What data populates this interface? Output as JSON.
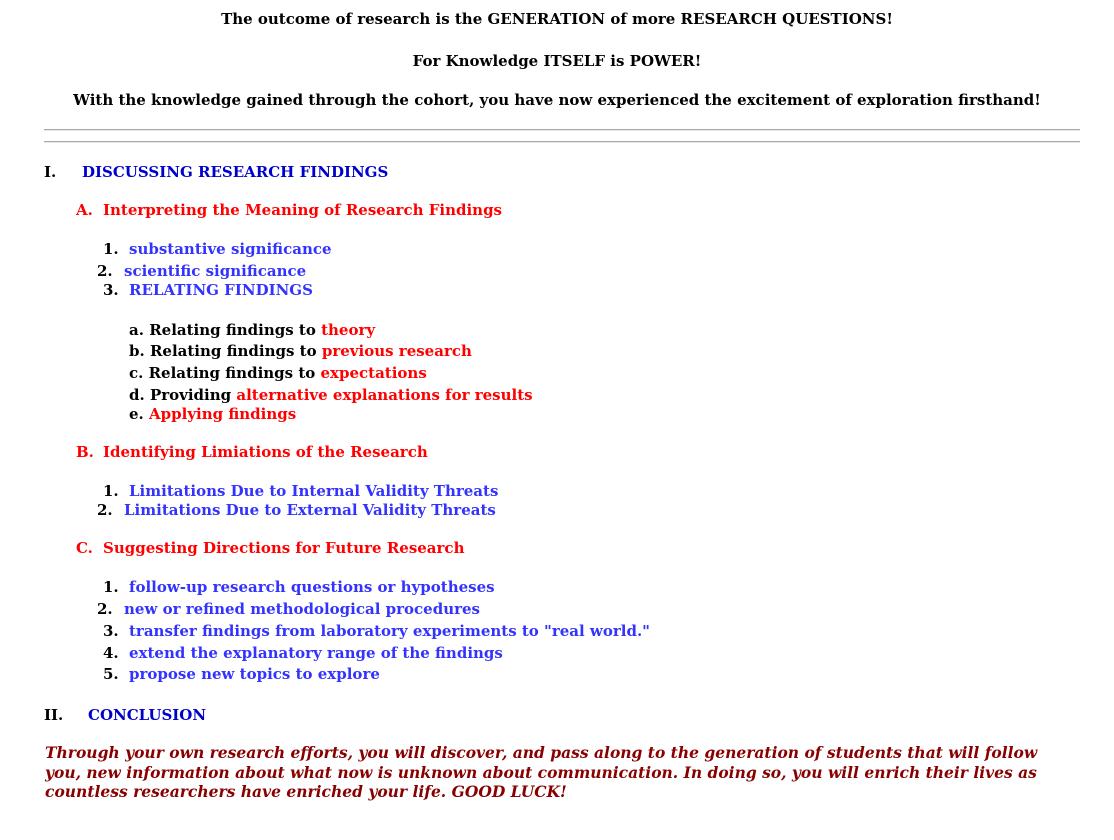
{
  "header": {
    "line1": "The outcome of research is the GENERATION of more RESEARCH QUESTIONS!",
    "line2": "For Knowledge ITSELF is POWER!",
    "line3": "With the knowledge gained through the cohort, you have now experienced the excitement of exploration firsthand!"
  },
  "section1": {
    "numeral": "I.",
    "title": "DISCUSSING RESEARCH FINDINGS",
    "A": {
      "letter": "A.",
      "title": "Interpreting the Meaning of Research Findings",
      "items": [
        {
          "num": "1.",
          "text": "substantive significance"
        },
        {
          "num": "2.",
          "text": "scientific significance"
        },
        {
          "num": "3.",
          "text": "RELATING FINDINGS"
        }
      ],
      "sub": [
        {
          "letter": "a.",
          "prefix": "Relating findings to",
          "highlight": "theory"
        },
        {
          "letter": "b.",
          "prefix": "Relating findings to",
          "highlight": "previous research"
        },
        {
          "letter": "c.",
          "prefix": "Relating findings to",
          "highlight": "expectations"
        },
        {
          "letter": "d.",
          "prefix": "Providing",
          "highlight": "alternative explanations for results"
        },
        {
          "letter": "e.",
          "prefix": "",
          "highlight": "Applying findings"
        }
      ]
    },
    "B": {
      "letter": "B.",
      "title": "Identifying Limiations of the Research",
      "items": [
        {
          "num": "1.",
          "text": "Limitations Due to Internal Validity Threats"
        },
        {
          "num": "2.",
          "text": "Limitations Due to External Validity Threats"
        }
      ]
    },
    "C": {
      "letter": "C.",
      "title": "Suggesting Directions for Future Research",
      "items": [
        {
          "num": "1.",
          "text": "follow-up research questions or hypotheses"
        },
        {
          "num": "2.",
          "text": "new or refined methodological procedures"
        },
        {
          "num": "3.",
          "text": "transfer findings from laboratory experiments to \"real world.\""
        },
        {
          "num": "4.",
          "text": "extend the explanatory range of the findings"
        },
        {
          "num": "5.",
          "text": "propose new topics to explore"
        }
      ]
    }
  },
  "section2": {
    "numeral": "II.",
    "title": "CONCLUSION",
    "closing": "Through your own research efforts, you will discover, and pass along to the generation of students that will follow you, new information about what now is unknown about communication.  In doing so, you will enrich their lives as countless researchers have enriched your life.  GOOD LUCK!"
  },
  "colors": {
    "heading_blue": "#0000cc",
    "item_blue": "#3333ff",
    "subheading_red": "#ff0000",
    "closing_maroon": "#880000"
  }
}
